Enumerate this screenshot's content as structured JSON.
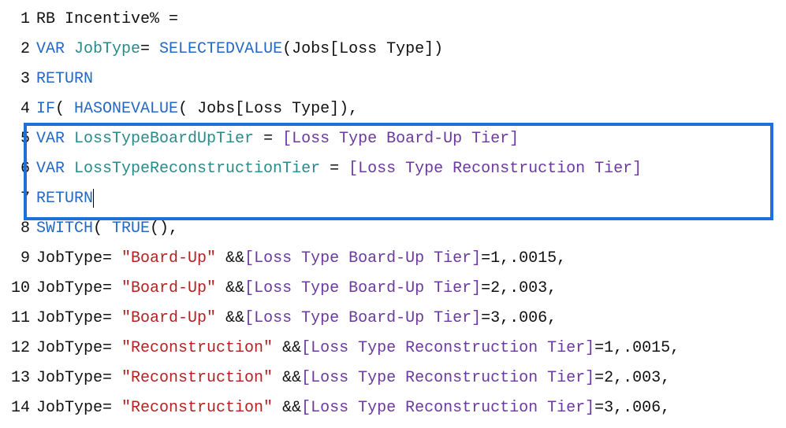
{
  "lines": [
    {
      "n": "1",
      "tokens": [
        {
          "t": "RB Incentive% ",
          "c": "txt"
        },
        {
          "t": "=",
          "c": "txt"
        }
      ]
    },
    {
      "n": "2",
      "tokens": [
        {
          "t": "VAR ",
          "c": "kw"
        },
        {
          "t": "JobType",
          "c": "ident"
        },
        {
          "t": "= ",
          "c": "txt"
        },
        {
          "t": "SELECTEDVALUE",
          "c": "fn"
        },
        {
          "t": "(Jobs[Loss Type])",
          "c": "txt"
        }
      ]
    },
    {
      "n": "3",
      "tokens": [
        {
          "t": "RETURN",
          "c": "kw"
        }
      ]
    },
    {
      "n": "4",
      "tokens": [
        {
          "t": "IF",
          "c": "fn"
        },
        {
          "t": "( ",
          "c": "txt"
        },
        {
          "t": "HASONEVALUE",
          "c": "fn"
        },
        {
          "t": "( Jobs[Loss Type]),",
          "c": "txt"
        }
      ]
    },
    {
      "n": "5",
      "hl": true,
      "tokens": [
        {
          "t": "VAR ",
          "c": "kw"
        },
        {
          "t": "LossTypeBoardUpTier",
          "c": "ident"
        },
        {
          "t": " = ",
          "c": "txt"
        },
        {
          "t": "[Loss Type Board-Up Tier]",
          "c": "ref"
        }
      ]
    },
    {
      "n": "6",
      "hl": true,
      "tokens": [
        {
          "t": "VAR ",
          "c": "kw"
        },
        {
          "t": "LossTypeReconstructionTier",
          "c": "ident"
        },
        {
          "t": " = ",
          "c": "txt"
        },
        {
          "t": "[Loss Type Reconstruction Tier]",
          "c": "ref"
        }
      ]
    },
    {
      "n": "7",
      "hl": true,
      "tokens": [
        {
          "t": "RETURN",
          "c": "kw"
        }
      ],
      "caret": true
    },
    {
      "n": "8",
      "tokens": [
        {
          "t": "SWITCH",
          "c": "fn"
        },
        {
          "t": "( ",
          "c": "txt"
        },
        {
          "t": "TRUE",
          "c": "fn"
        },
        {
          "t": "(),",
          "c": "txt"
        }
      ]
    },
    {
      "n": "9",
      "tokens": [
        {
          "t": "JobType= ",
          "c": "txt"
        },
        {
          "t": "\"Board-Up\"",
          "c": "str"
        },
        {
          "t": " &&",
          "c": "txt"
        },
        {
          "t": "[Loss Type Board-Up Tier]",
          "c": "ref"
        },
        {
          "t": "=1,.0015,",
          "c": "txt"
        }
      ]
    },
    {
      "n": "10",
      "tokens": [
        {
          "t": "JobType= ",
          "c": "txt"
        },
        {
          "t": "\"Board-Up\"",
          "c": "str"
        },
        {
          "t": " &&",
          "c": "txt"
        },
        {
          "t": "[Loss Type Board-Up Tier]",
          "c": "ref"
        },
        {
          "t": "=2,.003,",
          "c": "txt"
        }
      ]
    },
    {
      "n": "11",
      "tokens": [
        {
          "t": "JobType= ",
          "c": "txt"
        },
        {
          "t": "\"Board-Up\"",
          "c": "str"
        },
        {
          "t": " &&",
          "c": "txt"
        },
        {
          "t": "[Loss Type Board-Up Tier]",
          "c": "ref"
        },
        {
          "t": "=3,.006,",
          "c": "txt"
        }
      ]
    },
    {
      "n": "12",
      "tokens": [
        {
          "t": "JobType= ",
          "c": "txt"
        },
        {
          "t": "\"Reconstruction\"",
          "c": "str"
        },
        {
          "t": " &&",
          "c": "txt"
        },
        {
          "t": "[Loss Type Reconstruction Tier]",
          "c": "ref"
        },
        {
          "t": "=1,.0015,",
          "c": "txt"
        }
      ]
    },
    {
      "n": "13",
      "tokens": [
        {
          "t": "JobType= ",
          "c": "txt"
        },
        {
          "t": "\"Reconstruction\"",
          "c": "str"
        },
        {
          "t": " &&",
          "c": "txt"
        },
        {
          "t": "[Loss Type Reconstruction Tier]",
          "c": "ref"
        },
        {
          "t": "=2,.003,",
          "c": "txt"
        }
      ]
    },
    {
      "n": "14",
      "tokens": [
        {
          "t": "JobType= ",
          "c": "txt"
        },
        {
          "t": "\"Reconstruction\"",
          "c": "str"
        },
        {
          "t": " &&",
          "c": "txt"
        },
        {
          "t": "[Loss Type Reconstruction Tier]",
          "c": "ref"
        },
        {
          "t": "=3,.006,",
          "c": "txt"
        }
      ]
    }
  ]
}
